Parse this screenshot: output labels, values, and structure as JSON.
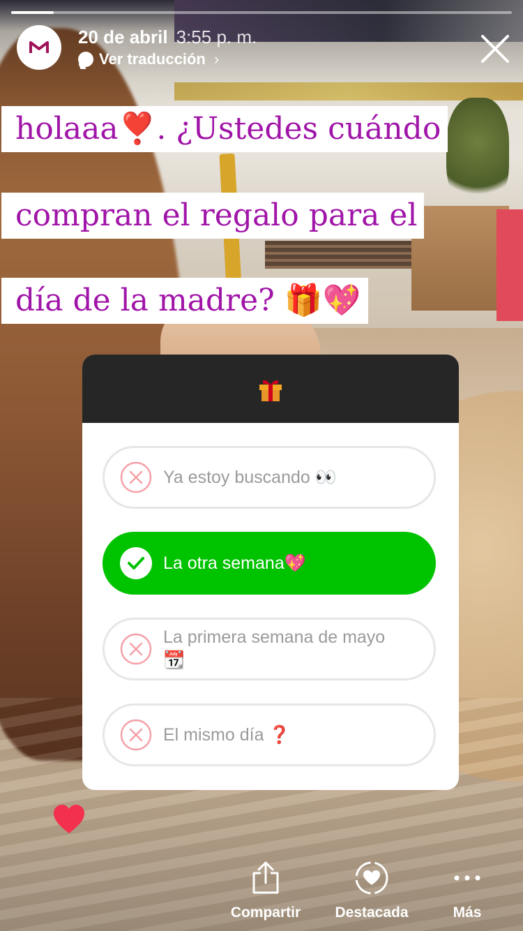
{
  "story": {
    "progress_fraction": 0.085,
    "date": "20 de abril",
    "time": "3:55 p. m.",
    "translate_label": "Ver traducción",
    "translate_chevron": "›"
  },
  "caption": {
    "line1": "holaaa❣️. ¿Ustedes cuándo",
    "line2": "compran el regalo para el",
    "line3": "día de la madre? 🎁💖"
  },
  "quiz": {
    "header_icon": "gift-icon",
    "options": [
      {
        "label": "Ya estoy buscando 👀",
        "state": "wrong"
      },
      {
        "label": "La otra semana💖",
        "state": "correct"
      },
      {
        "label_line1": "La primera semana de mayo",
        "label_line2": "📆",
        "state": "wrong"
      },
      {
        "label": "El mismo día ❓",
        "state": "wrong"
      }
    ]
  },
  "bottom_bar": {
    "share_label": "Compartir",
    "highlight_label": "Destacada",
    "more_label": "Más"
  },
  "colors": {
    "caption_text": "#a014a8",
    "correct_green": "#00c300",
    "wrong_red": "#f4a0a8",
    "like_red": "#f3304d",
    "card_header": "#262626"
  }
}
